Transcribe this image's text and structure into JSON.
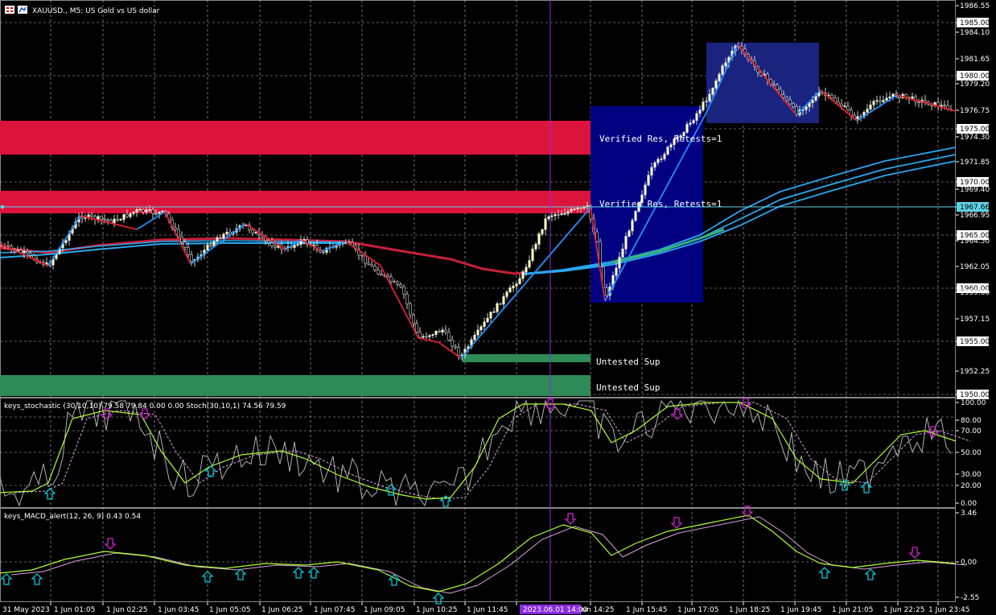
{
  "header": {
    "symbol_title": "XAUUSD., M5:  US Gold vs US dollar",
    "stoch_title": "keys_stochastic (30,10,10) 79.58 79.84 0.00 0.00 Stoch(30,10,1) 74.56 79.59",
    "macd_title": "keys_MACD_alert(12, 26, 9) 0.43 0.54"
  },
  "colors": {
    "background": "#000000",
    "grid": "#bfbfbf",
    "bull_candle": "#ffffb0",
    "bear_candle": "#ffffff",
    "resistance_zone": "#dc143c",
    "support_zone": "#2e8b57",
    "range_box": "#000080",
    "range_box_light": "#1a237e",
    "zigzag_up": "#1e90ff",
    "zigzag_down": "#e0202e",
    "ma_red": "#c8203a",
    "ma_blue": "#29a8f0",
    "ma_green": "#3cb371",
    "bid_line": "#5fd3e6",
    "vline": "#8a2be2",
    "stoch_main": "#adff2f",
    "stoch_signal": "#dda0dd",
    "stoch_raw": "#b0b0b0",
    "arrow_down": "#d020d0",
    "arrow_up": "#00c8d8"
  },
  "zones": [
    {
      "name": "resistance-zone-1",
      "label": "Verified Res, Retests=1",
      "type": "res"
    },
    {
      "name": "resistance-zone-2",
      "label": "Verified Res, Retests=1",
      "type": "res"
    },
    {
      "name": "support-zone-1",
      "label": "Untested Sup",
      "type": "sup"
    },
    {
      "name": "support-zone-2",
      "label": "Untested Sup",
      "type": "sup"
    }
  ],
  "price_axis": {
    "labels": [
      "1986.55",
      "1985.00",
      "1984.10",
      "1981.65",
      "1980.00",
      "1979.20",
      "1976.75",
      "1975.00",
      "1974.30",
      "1971.85",
      "1970.00",
      "1969.40",
      "1967.66",
      "1966.95",
      "1965.00",
      "1964.50",
      "1962.05",
      "1960.00",
      "1959.60",
      "1957.15",
      "1955.00",
      "1952.25",
      "1950.00"
    ],
    "boxed": [
      "1985.00",
      "1980.00",
      "1975.00",
      "1970.00",
      "1965.00",
      "1960.00",
      "1955.00",
      "1950.00"
    ],
    "current": "1967.66"
  },
  "stoch_axis": {
    "labels": [
      "100.00",
      "80.00",
      "70.00",
      "50.00",
      "30.00",
      "20.00",
      "0.00"
    ]
  },
  "macd_axis": {
    "labels": [
      "3.46",
      "0.00",
      "-2.55"
    ]
  },
  "time_axis": {
    "labels": [
      "31 May 2023",
      "1 Jun 01:05",
      "1 Jun 02:25",
      "1 Jun 03:45",
      "1 Jun 05:05",
      "1 Jun 06:25",
      "1 Jun 07:45",
      "1 Jun 09:05",
      "1 Jun 10:25",
      "1 Jun 11:45",
      "1 Jun 14:25",
      "1 Jun 15:45",
      "1 Jun 17:05",
      "1 Jun 18:25",
      "1 Jun 19:45",
      "1 Jun 21:05",
      "1 Jun 22:25",
      "1 Jun 23:45"
    ],
    "cursor_label": "2023.06.01 14:00"
  },
  "icons": {
    "chart_icon": "chart-grid-icon",
    "depth_icon": "depth-of-market-icon"
  }
}
